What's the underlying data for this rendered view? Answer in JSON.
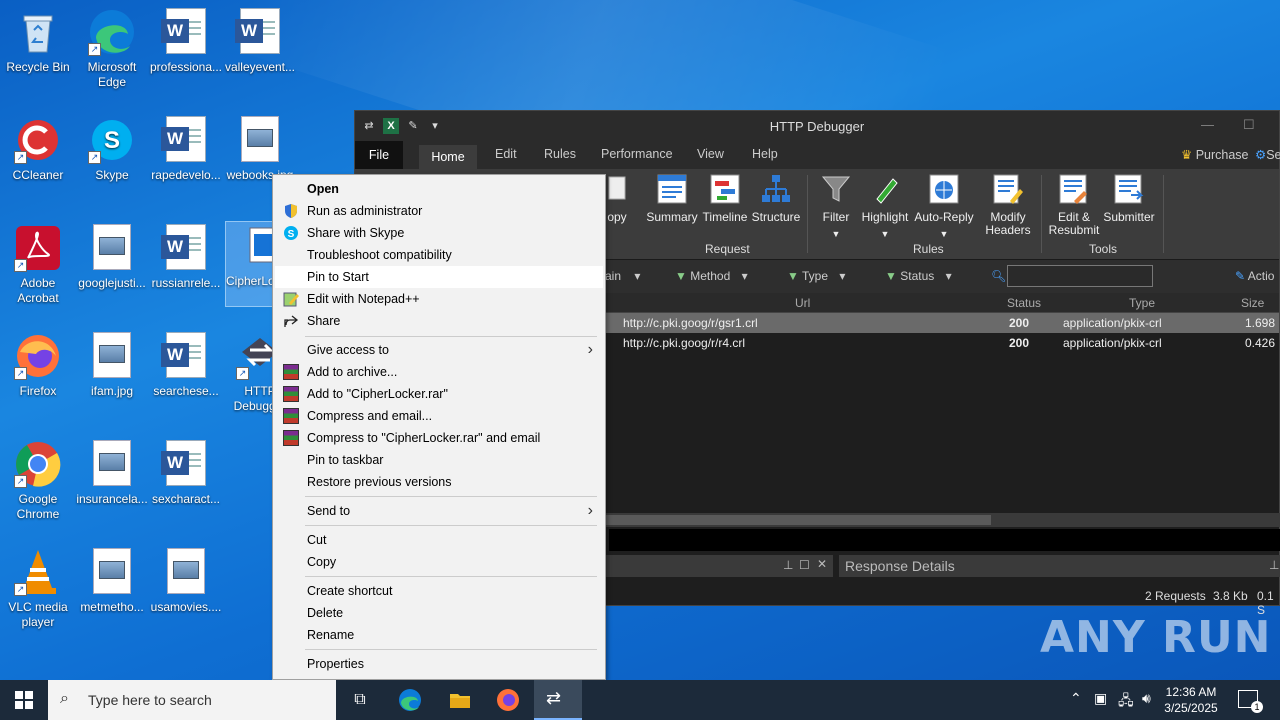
{
  "desktop": {
    "icons": [
      {
        "label": "Recycle Bin"
      },
      {
        "label": "Microsoft Edge"
      },
      {
        "label": "professiona..."
      },
      {
        "label": "valleyevent..."
      },
      {
        "label": "CCleaner"
      },
      {
        "label": "Skype"
      },
      {
        "label": "rapedevelo..."
      },
      {
        "label": "webooks.jpg"
      },
      {
        "label": "Adobe Acrobat"
      },
      {
        "label": "googlejusti..."
      },
      {
        "label": "russianrele..."
      },
      {
        "label": "CipherLocker.exe"
      },
      {
        "label": "Firefox"
      },
      {
        "label": "ifam.jpg"
      },
      {
        "label": "searchese..."
      },
      {
        "label": "HTTP Debugger"
      },
      {
        "label": "Google Chrome"
      },
      {
        "label": "insurancela..."
      },
      {
        "label": "sexcharact..."
      },
      {
        "label": "VLC media player"
      },
      {
        "label": "metmetho..."
      },
      {
        "label": "usamovies...."
      }
    ]
  },
  "app": {
    "title": "HTTP Debugger",
    "menu_tabs": [
      "File",
      "Home",
      "Edit",
      "Rules",
      "Performance",
      "View",
      "Help"
    ],
    "purchase_label": "Purchase",
    "settings_label": "Se",
    "ribbon": {
      "copy_label": "opy",
      "request_buttons": [
        "Summary",
        "Timeline",
        "Structure"
      ],
      "request_group": "Request",
      "rules_buttons": [
        "Filter",
        "Highlight",
        "Auto-Reply",
        "Modify Headers"
      ],
      "rules_group": "Rules",
      "tools_buttons": [
        "Edit & Resubmit",
        "Submitter"
      ],
      "tools_group": "Tools"
    },
    "filters": [
      "ain",
      "Method",
      "Type",
      "Status"
    ],
    "actions_label": "Actio",
    "columns": [
      "Url",
      "Status",
      "Type",
      "Size"
    ],
    "rows": [
      {
        "url": "http://c.pki.goog/r/gsr1.crl",
        "status": "200",
        "type": "application/pkix-crl",
        "size": "1.698"
      },
      {
        "url": "http://c.pki.goog/r/r4.crl",
        "status": "200",
        "type": "application/pkix-crl",
        "size": "0.426"
      }
    ],
    "response_details": "Response Details",
    "status": {
      "requests": "2 Requests",
      "size": "3.8 Kb",
      "extra": "0.1 S"
    }
  },
  "context_menu": {
    "items": [
      "Open",
      "Run as administrator",
      "Share with Skype",
      "Troubleshoot compatibility",
      "Pin to Start",
      "Edit with Notepad++",
      "Share",
      "Give access to",
      "Add to archive...",
      "Add to \"CipherLocker.rar\"",
      "Compress and email...",
      "Compress to \"CipherLocker.rar\" and email",
      "Pin to taskbar",
      "Restore previous versions",
      "Send to",
      "Cut",
      "Copy",
      "Create shortcut",
      "Delete",
      "Rename",
      "Properties"
    ]
  },
  "taskbar": {
    "search_placeholder": "Type here to search",
    "time": "12:36 AM",
    "date": "3/25/2025",
    "notification_count": "1"
  },
  "watermark": "ANY RUN"
}
